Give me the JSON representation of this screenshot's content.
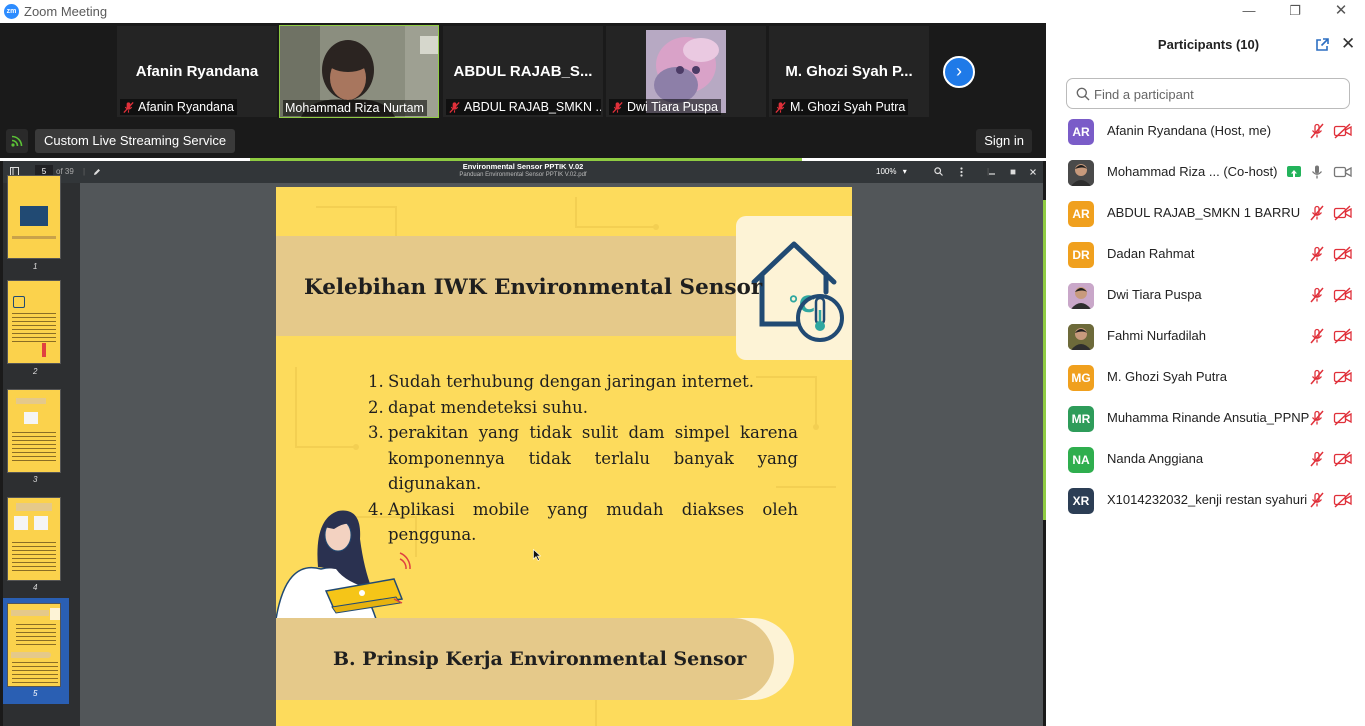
{
  "window": {
    "title": "Zoom Meeting",
    "logo_text": "zm",
    "controls": {
      "minimize": "—",
      "restore": "❐",
      "close": "✕"
    }
  },
  "video_strip": {
    "tiles": [
      {
        "name": "Afanin Ryandana",
        "label": "Afanin Ryandana",
        "muted": true,
        "video": false
      },
      {
        "name": "Mohammad Riza Nurtam",
        "label": "Mohammad Riza Nurtam",
        "muted": false,
        "video": true,
        "active_speaker": true
      },
      {
        "name": "ABDUL RAJAB_S...",
        "label": "ABDUL RAJAB_SMKN ...",
        "muted": true,
        "video": false
      },
      {
        "name": "Dwi Tiara Puspa",
        "label": "Dwi Tiara Puspa",
        "muted": true,
        "video": true
      },
      {
        "name": "M. Ghozi Syah P...",
        "label": "M. Ghozi Syah Putra",
        "muted": true,
        "video": false
      }
    ],
    "next_icon": "›"
  },
  "toolbar": {
    "live_label": "Custom Live Streaming Service",
    "signin_label": "Sign in",
    "rss_icon": "rss-icon"
  },
  "pdf_viewer": {
    "title": "Environmental Sensor PPTIK V.02",
    "subtitle": "Panduan Environmental Sensor PPTIK V.02.pdf",
    "current_page": "5",
    "page_of": "of 39",
    "zoom": "100%",
    "zoom_caret": "▾",
    "thumbnails": [
      "1",
      "2",
      "3",
      "4",
      "5"
    ],
    "active_thumbnail": "5",
    "slide": {
      "heading": "Kelebihan IWK Environmental Sensor",
      "list": [
        {
          "num": "1.",
          "text": "Sudah terhubung dengan jaringan internet."
        },
        {
          "num": "2.",
          "text": "dapat mendeteksi suhu."
        },
        {
          "num": "3.",
          "text": "perakitan yang tidak sulit dam simpel karena komponennya tidak terlalu banyak yang digunakan."
        },
        {
          "num": "4.",
          "text": "Aplikasi mobile yang mudah diakses oleh pengguna."
        }
      ],
      "section_heading": "B. Prinsip Kerja Environmental Sensor",
      "icon_text": "°C"
    }
  },
  "participants": {
    "header": "Participants (10)",
    "search_placeholder": "Find a participant",
    "close_icon": "✕",
    "list": [
      {
        "initials": "AR",
        "name": "Afanin Ryandana (Host, me)",
        "color": "#7a5cc8",
        "mic": "muted",
        "cam": "off",
        "photo": false
      },
      {
        "initials": "",
        "name": "Mohammad Riza ...  (Co-host)",
        "color": "#4a4a4a",
        "mic": "on",
        "cam": "on",
        "photo": true,
        "sharing": true
      },
      {
        "initials": "AR",
        "name": "ABDUL RAJAB_SMKN 1 BARRU",
        "color": "#f0a01e",
        "mic": "muted",
        "cam": "off",
        "photo": false
      },
      {
        "initials": "DR",
        "name": "Dadan Rahmat",
        "color": "#f0a01e",
        "mic": "muted",
        "cam": "off",
        "photo": false
      },
      {
        "initials": "",
        "name": "Dwi Tiara Puspa",
        "color": "#c9a7c9",
        "mic": "muted",
        "cam": "off",
        "photo": true
      },
      {
        "initials": "",
        "name": "Fahmi Nurfadilah",
        "color": "#6d6a3a",
        "mic": "muted",
        "cam": "off",
        "photo": true
      },
      {
        "initials": "MG",
        "name": "M. Ghozi Syah Putra",
        "color": "#f0a01e",
        "mic": "muted",
        "cam": "off",
        "photo": false
      },
      {
        "initials": "MR",
        "name": "Muhamma Rinande Ansutia_PPNP",
        "color": "#2e9c5a",
        "mic": "muted",
        "cam": "off",
        "photo": false
      },
      {
        "initials": "NA",
        "name": "Nanda  Anggiana",
        "color": "#2fae4e",
        "mic": "muted",
        "cam": "off",
        "photo": false
      },
      {
        "initials": "XR",
        "name": "X1014232032_kenji restan syahuri",
        "color": "#2c3e55",
        "mic": "muted",
        "cam": "off",
        "photo": false
      }
    ]
  },
  "colors": {
    "accent": "#2d8cff",
    "active_border": "#8fcc42",
    "muted_red": "#e0303a",
    "slide_yellow": "#fddb5c"
  }
}
